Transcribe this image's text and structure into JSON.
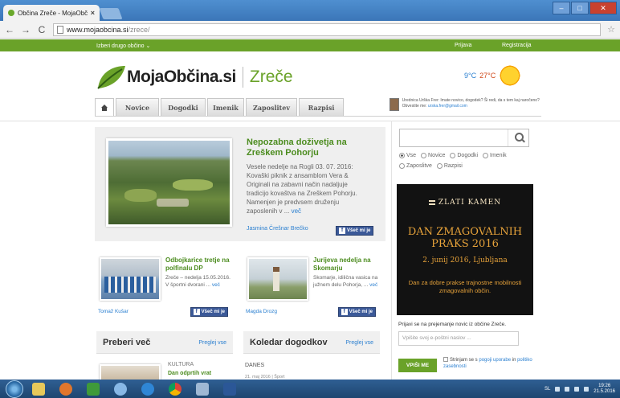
{
  "browser": {
    "tab_title": "Občina Zreče - MojaObči",
    "tab_close": "×",
    "url_host": "www.mojaobcina.si",
    "url_path": "/zrece/"
  },
  "topbar": {
    "choose_municipality": "Izberi drugo občino",
    "login": "Prijava",
    "register": "Registracija"
  },
  "logo": {
    "brand": "MojaObčina.si",
    "town": "Zreče"
  },
  "weather": {
    "low": "9°C",
    "high": "27°C"
  },
  "nav": {
    "tabs": [
      "Novice",
      "Dogodki",
      "Imenik",
      "Zaposlitev",
      "Razpisi"
    ]
  },
  "editor": {
    "text": "Urednica Urška Frer: Imate novico, dogodek? Ši redi, da s tem kaj naročeno? Obvestite me:",
    "email": "urska.frer@gmail.com"
  },
  "featured": {
    "title": "Nepozabna doživetja na Zreškem Pohorju",
    "body": "Vesele nedelje na Rogli 03. 07. 2016: Kovaški piknik z ansamblom Vera & Originali na zabavni način nadaljuje tradicijo kovaštva na Zreškem Pohorju. Namenjen je predvsem druženju zaposlenih v ...",
    "more": "več",
    "author": "Jasmina Črešnar Brečko",
    "like": "Všeč mi je"
  },
  "cards": [
    {
      "title": "Odbojkarice tretje na polfinalu DP",
      "body": "Zreče – nedelja 15.05.2016. V športni dvorani ...",
      "more": "več",
      "author": "Tomaž Kušar",
      "like": "Všeč mi je"
    },
    {
      "title": "Jurijeva nedelja na Skomarju",
      "body": "Skomarje, idilična vasica na južnem delu Pohorja, ...",
      "more": "več",
      "author": "Magda Drozg",
      "like": "Všeč mi je"
    }
  ],
  "sections": {
    "read_more": "Preberi več",
    "calendar": "Koledar dogodkov",
    "see_all": "Preglej vse"
  },
  "bottom": {
    "category": "KULTURA",
    "article_title": "Dan odprtih vrat",
    "today": "DANES",
    "today_date": "21. maj 2016 | Šport"
  },
  "sidebar": {
    "search_placeholder": "",
    "filters": [
      "Vse",
      "Novice",
      "Dogodki",
      "Imenik",
      "Zaposlitve",
      "Razpisi"
    ],
    "filter_selected": "Vse"
  },
  "ad": {
    "brand": "ZLATI KAMEN",
    "headline": "DAN ZMAGOVALNIH PRAKS 2016",
    "date": "2. junij 2016, Ljubljana",
    "description": "Dan za dobre prakse trajnostne mobilnosti zmagovalnih občin."
  },
  "newsletter": {
    "label": "Prijavi se na prejemanje novic iz občine Zreče.",
    "placeholder": "Vpišite svoj e-poštni naslov ...",
    "button": "VPIŠI ME",
    "agree_prefix": "Strinjam se s",
    "terms": "pogoji uporabe",
    "agree_mid": "in",
    "privacy": "politiko zasebnosti"
  },
  "taskbar": {
    "lang": "SL",
    "time": "19:26",
    "date": "21.5.2016"
  },
  "colors": {
    "brand_green": "#6aa229",
    "link_blue": "#2a7fd0",
    "facebook": "#3b5998"
  }
}
